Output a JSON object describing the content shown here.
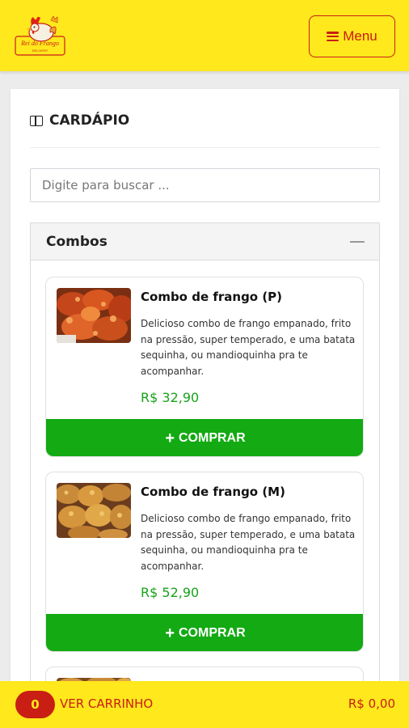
{
  "header": {
    "logo_text": "Rei do Frango",
    "logo_subtext": "DELIVERY",
    "menu_label": "Menu",
    "menu_icon": "bars-icon"
  },
  "page": {
    "title": "CARDÁPIO",
    "title_icon": "book-open-icon"
  },
  "search": {
    "placeholder": "Digite para buscar ...",
    "value": ""
  },
  "category": {
    "name": "Combos",
    "toggle_icon": "minus-icon",
    "products": [
      {
        "name": "Combo de frango (P)",
        "description": "Delicioso combo de frango empanado, frito na pressão, super temperado, e uma batata sequinha, ou mandioquinha pra te acompanhar.",
        "price": "R$ 32,90",
        "buy_label": "COMPRAR",
        "buy_icon": "plus-icon"
      },
      {
        "name": "Combo de frango (M)",
        "description": "Delicioso combo de frango empanado, frito na pressão, super temperado, e uma batata sequinha, ou mandioquinha pra te acompanhar.",
        "price": "R$ 52,90",
        "buy_label": "COMPRAR",
        "buy_icon": "plus-icon"
      }
    ]
  },
  "cart": {
    "count": "0",
    "label": "VER CARRINHO",
    "total": "R$ 0,00"
  },
  "colors": {
    "brand_yellow": "#ffe81c",
    "brand_red": "#c81e14",
    "buy_green": "#13aa13",
    "price_green": "#17a31a"
  }
}
